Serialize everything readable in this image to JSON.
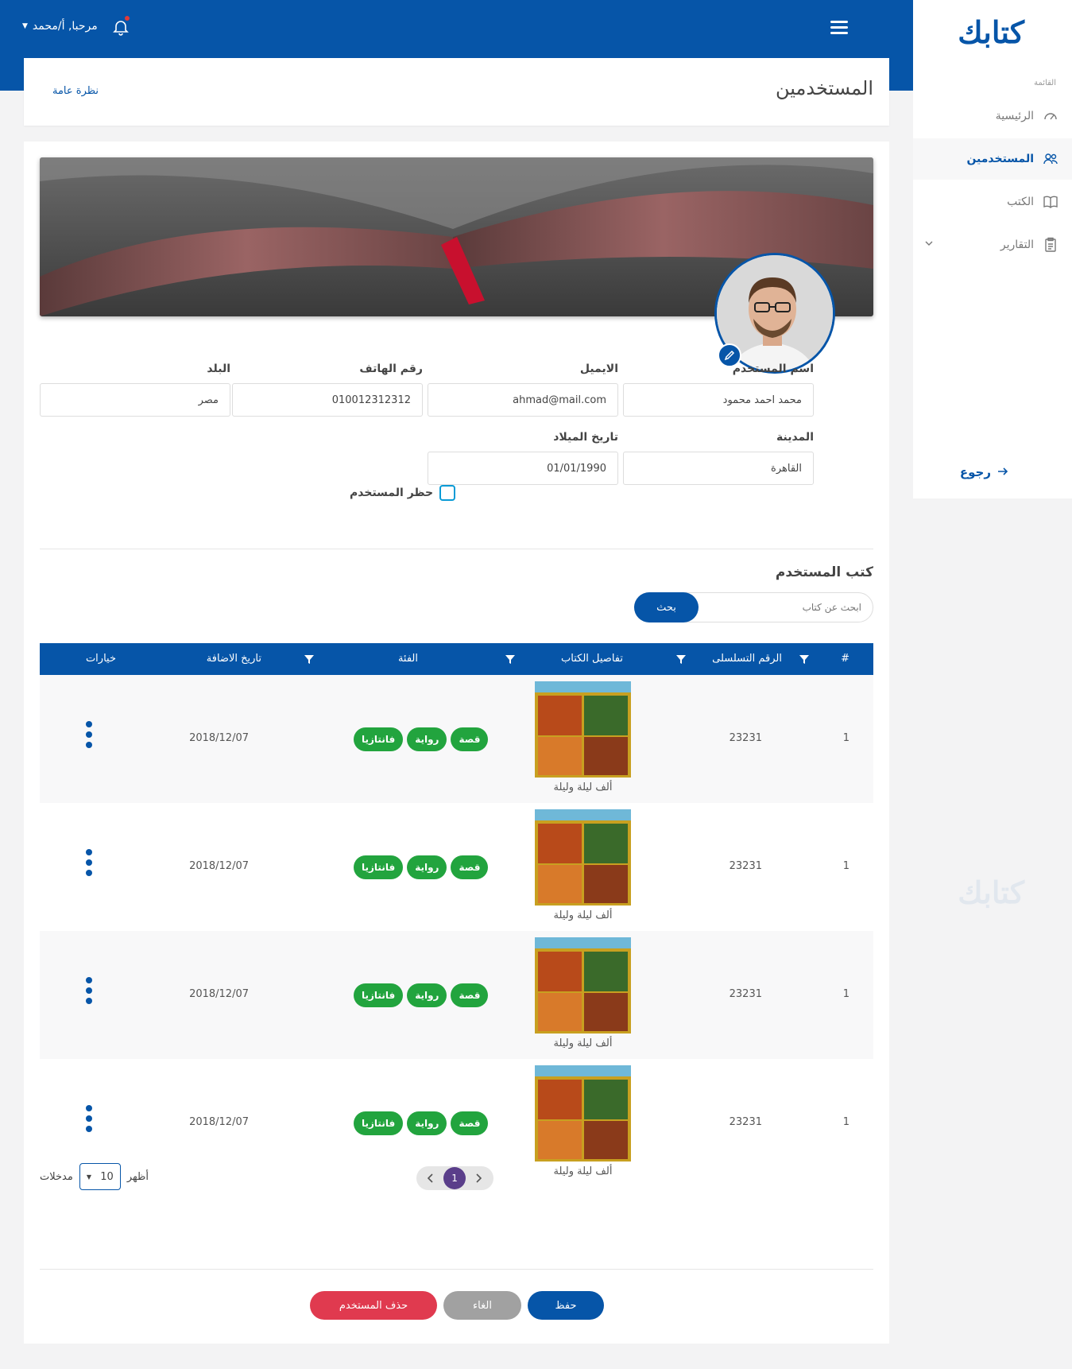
{
  "topbar": {
    "greeting": "مرحبا, أ/محمد"
  },
  "sidebar": {
    "logo": "كتابك",
    "menu_label": "القائمة",
    "items": [
      {
        "label": "الرئيسية"
      },
      {
        "label": "المستخدمين"
      },
      {
        "label": "الكتب"
      },
      {
        "label": "التقارير"
      }
    ],
    "back": "رجوع"
  },
  "header": {
    "title": "المستخدمين",
    "overview": "نظرة عامة"
  },
  "form": {
    "username": {
      "label": "اسم المستخدم",
      "value": "محمد احمد محمود"
    },
    "email": {
      "label": "الايميل",
      "value": "ahmad@mail.com"
    },
    "phone": {
      "label": "رقم الهاتف",
      "value": "010012312312"
    },
    "country": {
      "label": "البلد",
      "value": "مصر"
    },
    "city": {
      "label": "المدينة",
      "value": "القاهرة"
    },
    "birthdate": {
      "label": "تاريخ الميلاد",
      "value": "01/01/1990"
    },
    "block_user": "حظر المستخدم"
  },
  "books": {
    "title": "كتب المستخدم",
    "search_placeholder": "ابحث عن كتاب",
    "search_button": "بحث",
    "columns": [
      "#",
      "الرقم التسلسلى",
      "تفاصيل الكتاب",
      "الفئة",
      "تاريخ الاضافة",
      "خيارات"
    ],
    "rows": [
      {
        "num": "1",
        "serial": "23231",
        "book": "ألف ليلة وليلة",
        "tags": [
          "قصة",
          "رواية",
          "فانتازيا"
        ],
        "date": "2018/12/07"
      },
      {
        "num": "1",
        "serial": "23231",
        "book": "ألف ليلة وليلة",
        "tags": [
          "قصة",
          "رواية",
          "فانتازيا"
        ],
        "date": "2018/12/07"
      },
      {
        "num": "1",
        "serial": "23231",
        "book": "ألف ليلة وليلة",
        "tags": [
          "قصة",
          "رواية",
          "فانتازيا"
        ],
        "date": "2018/12/07"
      },
      {
        "num": "1",
        "serial": "23231",
        "book": "ألف ليلة وليلة",
        "tags": [
          "قصة",
          "رواية",
          "فانتازيا"
        ],
        "date": "2018/12/07"
      }
    ]
  },
  "pagination": {
    "current": "1",
    "show": "أظهر",
    "per_page": "10",
    "entries": "مدخلات"
  },
  "actions": {
    "save": "حفظ",
    "cancel": "الغاء",
    "delete": "حذف المستخدم"
  },
  "colors": {
    "primary": "#0655a8",
    "tag_green": "#22a43e",
    "delete_red": "#e03a4f",
    "cancel_gray": "#a1a1a1"
  }
}
